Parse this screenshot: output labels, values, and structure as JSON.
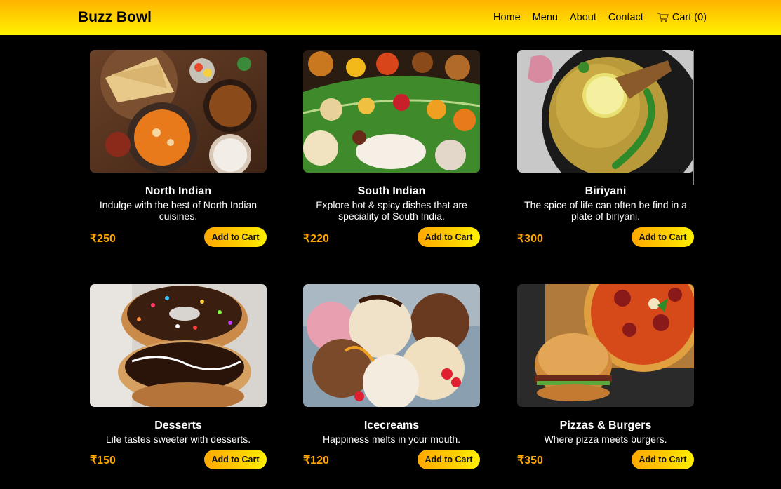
{
  "brand": "Buzz Bowl",
  "nav": {
    "home": "Home",
    "menu": "Menu",
    "about": "About",
    "contact": "Contact",
    "cart": "Cart (0)",
    "cart_icon": "shopping-cart-icon"
  },
  "colors": {
    "accent": "#ffa500",
    "navbar_gradient": [
      "#ffb300",
      "#fff200"
    ],
    "background": "#000000"
  },
  "products": [
    {
      "name": "North Indian",
      "description": "Indulge with the best of North Indian cuisines.",
      "price": "₹250",
      "button": "Add to Cart"
    },
    {
      "name": "South Indian",
      "description": "Explore hot & spicy dishes that are speciality of South India.",
      "price": "₹220",
      "button": "Add to Cart"
    },
    {
      "name": "Biriyani",
      "description": "The spice of life can often be find in a plate of biriyani.",
      "price": "₹300",
      "button": "Add to Cart"
    },
    {
      "name": "Desserts",
      "description": "Life tastes sweeter with desserts.",
      "price": "₹150",
      "button": "Add to Cart"
    },
    {
      "name": "Icecreams",
      "description": "Happiness melts in your mouth.",
      "price": "₹120",
      "button": "Add to Cart"
    },
    {
      "name": "Pizzas & Burgers",
      "description": "Where pizza meets burgers.",
      "price": "₹350",
      "button": "Add to Cart"
    }
  ]
}
